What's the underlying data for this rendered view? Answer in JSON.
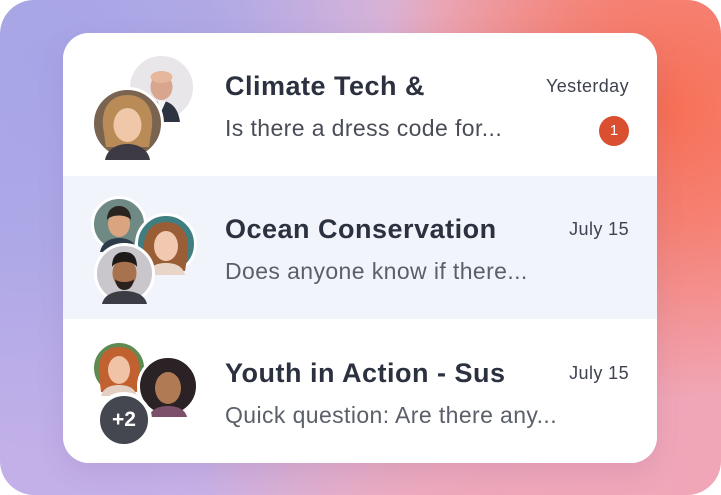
{
  "conversations": [
    {
      "title": "Climate Tech &",
      "preview": "Is there a dress code for...",
      "time": "Yesterday",
      "unread_count": "1"
    },
    {
      "title": "Ocean Conservation",
      "preview": "Does anyone know if there...",
      "time": "July 15"
    },
    {
      "title": "Youth in Action - Sus",
      "preview": "Quick question: Are there any...",
      "time": "July 15",
      "extra_members": "+2"
    }
  ],
  "colors": {
    "unread_badge": "#d94f30",
    "selected_row": "#f2f4fc",
    "title_text": "#2c3140"
  }
}
